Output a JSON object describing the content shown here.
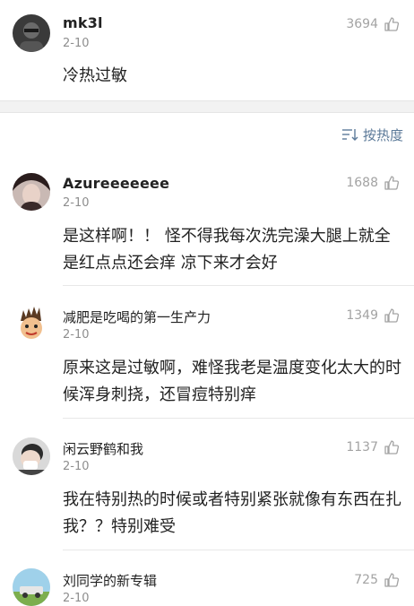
{
  "comments": [
    {
      "username": "mk3l",
      "date": "2-10",
      "likes": "3694",
      "text": "冷热过敏"
    },
    {
      "username": "Azureeeeeee",
      "date": "2-10",
      "likes": "1688",
      "text": "是这样啊！！ 怪不得我每次洗完澡大腿上就全是红点点还会痒 凉下来才会好"
    },
    {
      "username": "减肥是吃喝的第一生产力",
      "date": "2-10",
      "likes": "1349",
      "text": "原来这是过敏啊，难怪我老是温度变化太大的时候浑身刺挠，还冒痘特别痒"
    },
    {
      "username": "闲云野鹤和我",
      "date": "2-10",
      "likes": "1137",
      "text": "我在特别热的时候或者特别紧张就像有东西在扎我？？特别难受"
    },
    {
      "username": "刘同学的新专辑",
      "date": "2-10",
      "likes": "725",
      "text": ""
    }
  ],
  "sort": {
    "label": "按热度",
    "icon": "sort-icon"
  },
  "icons": {
    "like": "thumbs-up-icon"
  },
  "colors": {
    "sort_accent": "#5c7a99",
    "meta_gray": "#a3a3a3"
  }
}
